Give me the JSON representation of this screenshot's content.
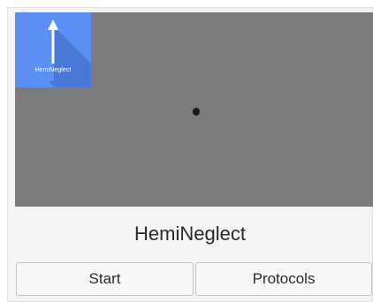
{
  "preview": {
    "icon_label": "HemiNeglect",
    "background_color": "#7b7b7b",
    "icon_color": "#5b8ff4"
  },
  "app": {
    "title": "HemiNeglect"
  },
  "buttons": {
    "start_label": "Start",
    "protocols_label": "Protocols"
  }
}
